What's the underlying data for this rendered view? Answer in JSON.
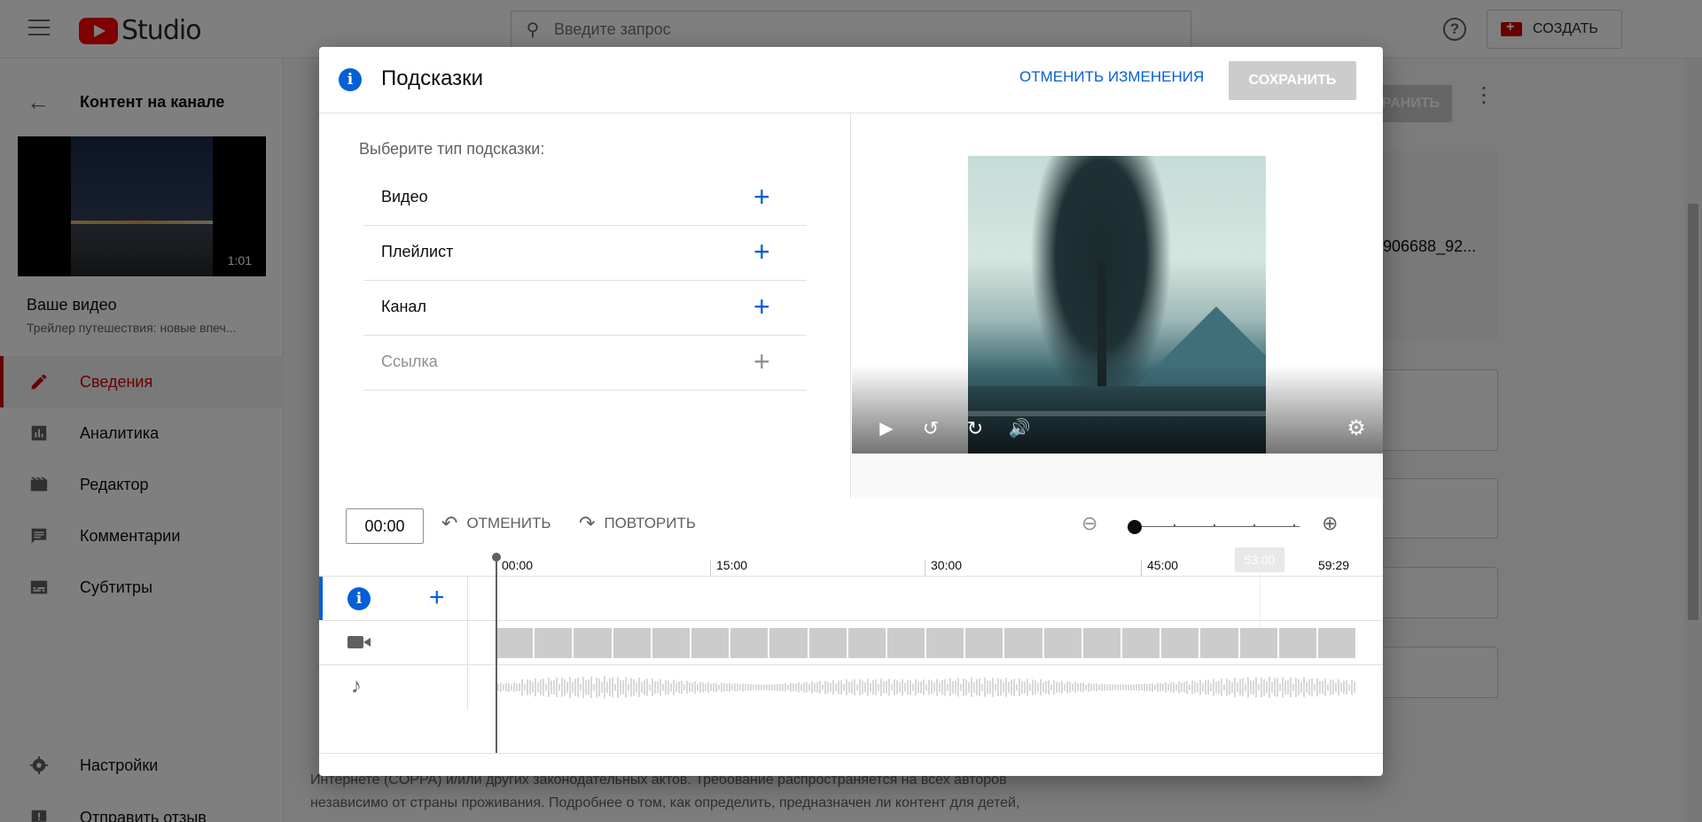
{
  "app": {
    "studio_label": "Studio",
    "search_placeholder": "Введите запрос",
    "create_label": "СОЗДАТЬ"
  },
  "sidebar": {
    "back_label": "Контент на канале",
    "thumb_duration": "1:01",
    "your_video": "Ваше видео",
    "video_title": "Трейлер путешествия: новые впеч...",
    "items": [
      {
        "label": "Сведения",
        "icon": "pencil-icon",
        "active": true
      },
      {
        "label": "Аналитика",
        "icon": "analytics-icon",
        "active": false
      },
      {
        "label": "Редактор",
        "icon": "editor-icon",
        "active": false
      },
      {
        "label": "Комментарии",
        "icon": "comments-icon",
        "active": false
      },
      {
        "label": "Субтитры",
        "icon": "subtitles-icon",
        "active": false
      }
    ],
    "bottom_items": [
      {
        "label": "Настройки",
        "icon": "gear-icon"
      },
      {
        "label": "Отправить отзыв",
        "icon": "feedback-icon"
      }
    ]
  },
  "background": {
    "save_partial": "РАНИТЬ",
    "id_fragment": "906688_92...",
    "text_lines": [
      "Интернете (COPPA) и/или других законодательных актов. Требование распространяется на всех авторов",
      "независимо от страны проживания. Подробнее о том, как определить, предназначен ли контент для детей,"
    ]
  },
  "modal": {
    "title": "Подсказки",
    "undo_all_label": "ОТМЕНИТЬ ИЗМЕНЕНИЯ",
    "save_label": "СОХРАНИТЬ",
    "choose_label": "Выберите тип подсказки:",
    "card_types": [
      {
        "label": "Видео",
        "enabled": true
      },
      {
        "label": "Плейлист",
        "enabled": true
      },
      {
        "label": "Канал",
        "enabled": true
      },
      {
        "label": "Ссылка",
        "enabled": false
      }
    ],
    "toolbar": {
      "time": "00:00",
      "undo_label": "ОТМЕНИТЬ",
      "redo_label": "ПОВТОРИТЬ"
    },
    "timeline": {
      "ruler": [
        "00:00",
        "15:00",
        "30:00",
        "45:00",
        "59:29"
      ],
      "hover_time": "53:00"
    }
  },
  "colors": {
    "accent_blue": "#065fd4",
    "brand_red": "#cc0000",
    "disabled_gray": "#cccccc"
  }
}
